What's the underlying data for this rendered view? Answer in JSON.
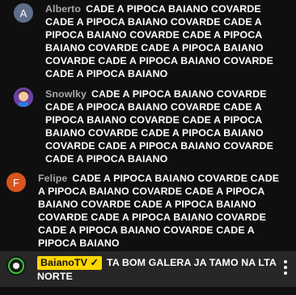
{
  "messages": [
    {
      "author": "Alberto",
      "avatar_letter": "A",
      "avatar_color": "#5f6e88",
      "text": "CADE A PIPOCA BAIANO COVARDE CADE A PIPOCA BAIANO COVARDE CADE A PIPOCA BAIANO COVARDE CADE A PIPOCA BAIANO COVARDE CADE A PIPOCA BAIANO COVARDE CADE A PIPOCA BAIANO COVARDE CADE A PIPOCA BAIANO"
    },
    {
      "author": "Snowlky",
      "avatar_letter": "",
      "avatar_color": "#7a4fb0",
      "text": "CADE A PIPOCA BAIANO COVARDE CADE A PIPOCA BAIANO COVARDE CADE A PIPOCA BAIANO COVARDE CADE A PIPOCA BAIANO COVARDE CADE A PIPOCA BAIANO COVARDE CADE A PIPOCA BAIANO COVARDE CADE A PIPOCA BAIANO"
    },
    {
      "author": "Felipe",
      "avatar_letter": "F",
      "avatar_color": "#d9541e",
      "text": "CADE A PIPOCA BAIANO COVARDE CADE A PIPOCA BAIANO COVARDE CADE A PIPOCA BAIANO COVARDE CADE A PIPOCA BAIANO COVARDE CADE A PIPOCA BAIANO COVARDE CADE A PIPOCA BAIANO COVARDE CADE A PIPOCA BAIANO"
    }
  ],
  "pinned": {
    "author": "BaianoTV",
    "verified_mark": "✓",
    "badge_color": "#ffd600",
    "text": "TA BOM GALERA JA TAMO NA LTA NORTE"
  },
  "icons": {
    "more_options": "more-vert-icon",
    "verified": "check-icon"
  }
}
